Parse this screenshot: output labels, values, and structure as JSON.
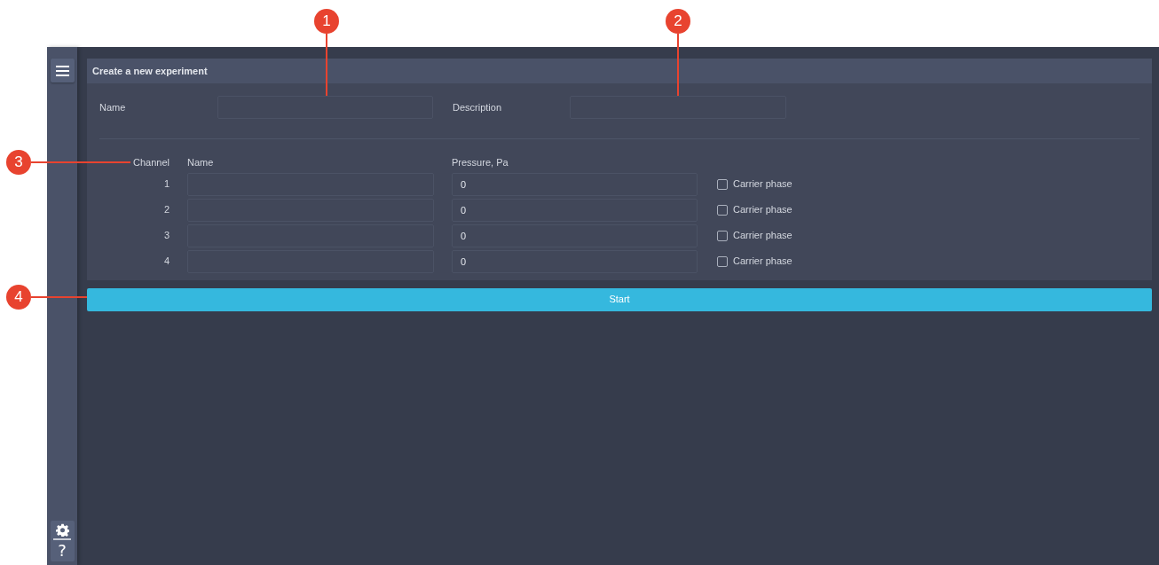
{
  "callouts": [
    {
      "number": "1"
    },
    {
      "number": "2"
    },
    {
      "number": "3"
    },
    {
      "number": "4"
    }
  ],
  "sidebar": {
    "help_label": "?"
  },
  "form": {
    "title": "Create a new experiment",
    "fields": [
      {
        "label": "Name"
      },
      {
        "label": "Description"
      }
    ],
    "channel_columns": [
      "Channel",
      "Name",
      "Pressure, Pa"
    ],
    "channels": [
      {
        "channel": "1",
        "pressure": "0",
        "option_label": "Carrier phase",
        "checked": false
      },
      {
        "channel": "2",
        "pressure": "0",
        "option_label": "Carrier phase",
        "checked": false
      },
      {
        "channel": "3",
        "pressure": "0",
        "option_label": "Carrier phase",
        "checked": false
      },
      {
        "channel": "4",
        "pressure": "0",
        "option_label": "Carrier phase",
        "checked": false
      }
    ],
    "start_button": "Start"
  }
}
